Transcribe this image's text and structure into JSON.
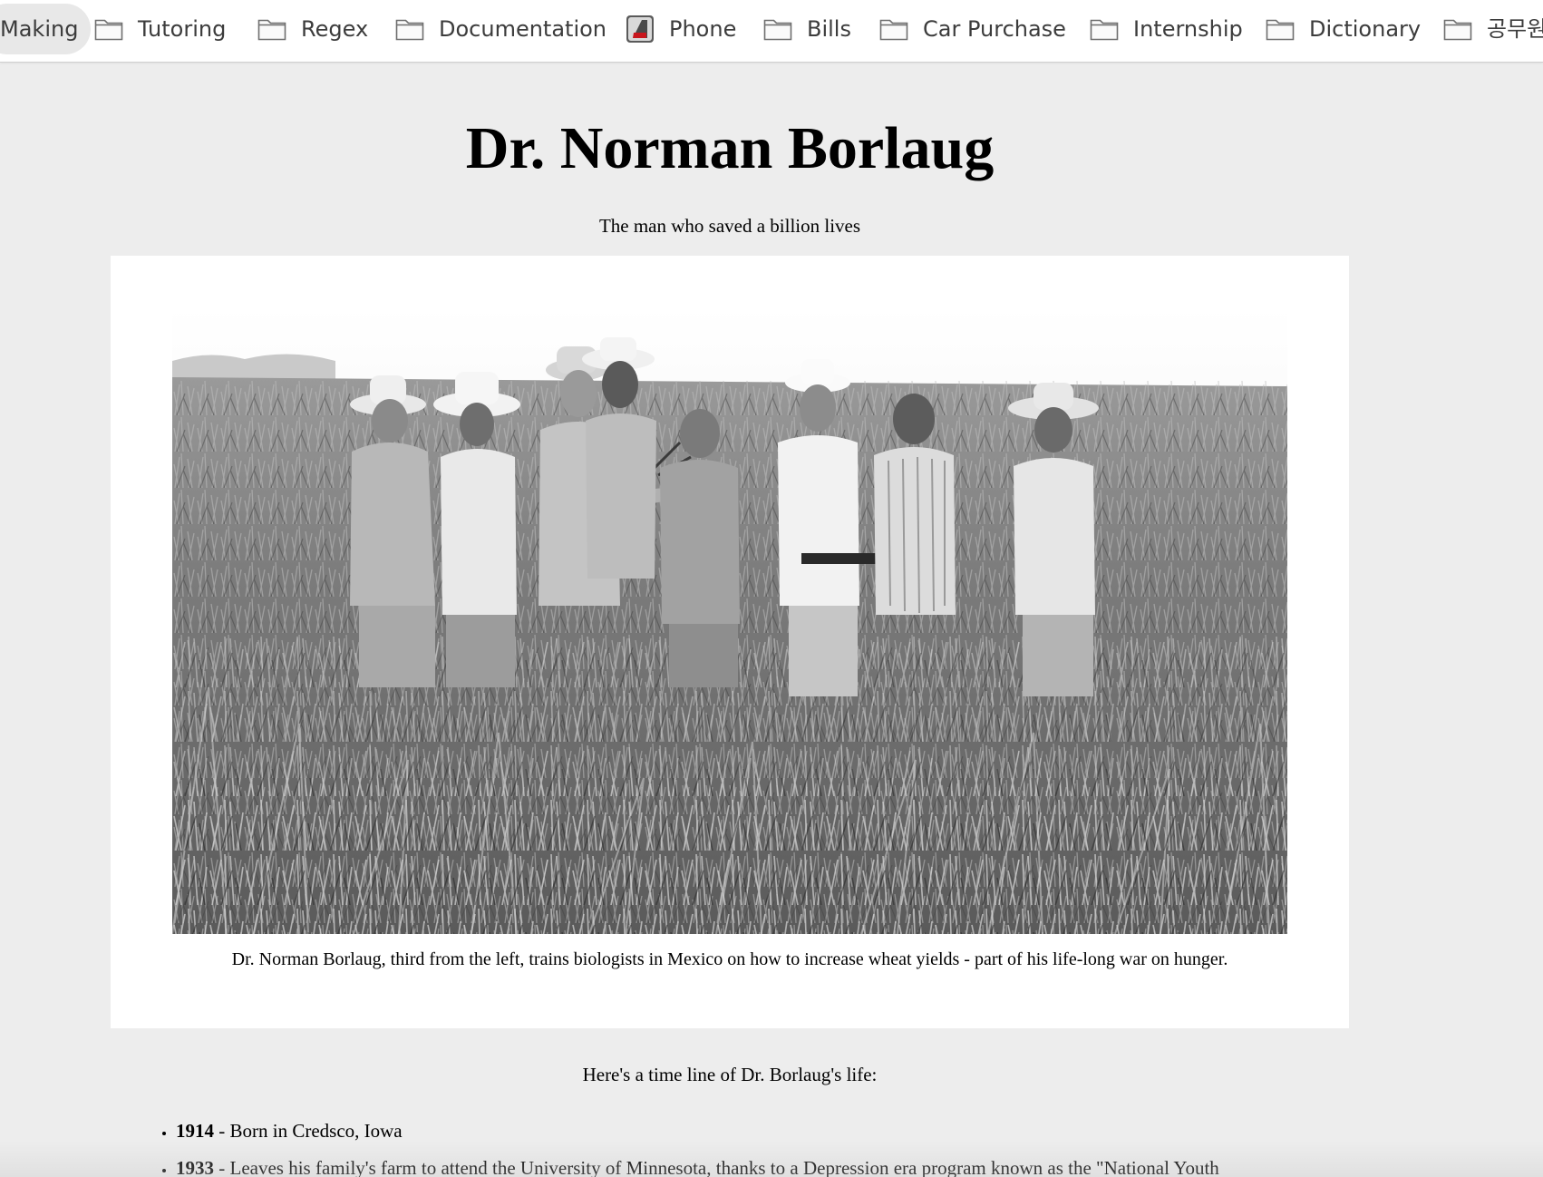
{
  "bookmarks": [
    {
      "label": "Making",
      "icon": "none",
      "active": true
    },
    {
      "label": "Tutoring",
      "icon": "folder-icon"
    },
    {
      "label": "Regex",
      "icon": "folder-icon"
    },
    {
      "label": "Documentation",
      "icon": "folder-icon"
    },
    {
      "label": "Phone",
      "icon": "phone-app-icon"
    },
    {
      "label": "Bills",
      "icon": "folder-icon"
    },
    {
      "label": "Car Purchase",
      "icon": "folder-icon"
    },
    {
      "label": "Internship",
      "icon": "folder-icon"
    },
    {
      "label": "Dictionary",
      "icon": "folder-icon"
    },
    {
      "label": "공무원",
      "icon": "folder-icon"
    }
  ],
  "page": {
    "title": "Dr. Norman Borlaug",
    "tagline": "The man who saved a billion lives",
    "figure": {
      "caption": "Dr. Norman Borlaug, third from the left, trains biologists in Mexico on how to increase wheat yields - part of his life-long war on hunger."
    },
    "timeline_intro": "Here's a time line of Dr. Borlaug's life:",
    "timeline": [
      {
        "year": "1914",
        "text": " - Born in Credsco, Iowa"
      },
      {
        "year": "1933",
        "text": " - Leaves his family's farm to attend the University of Minnesota, thanks to a Depression era program known as the \"National Youth"
      }
    ]
  },
  "colors": {
    "page_background": "#ededed",
    "card_background": "#ffffff",
    "bookmark_text": "#3c3c3c",
    "phone_icon_accent": "#c8161d"
  }
}
